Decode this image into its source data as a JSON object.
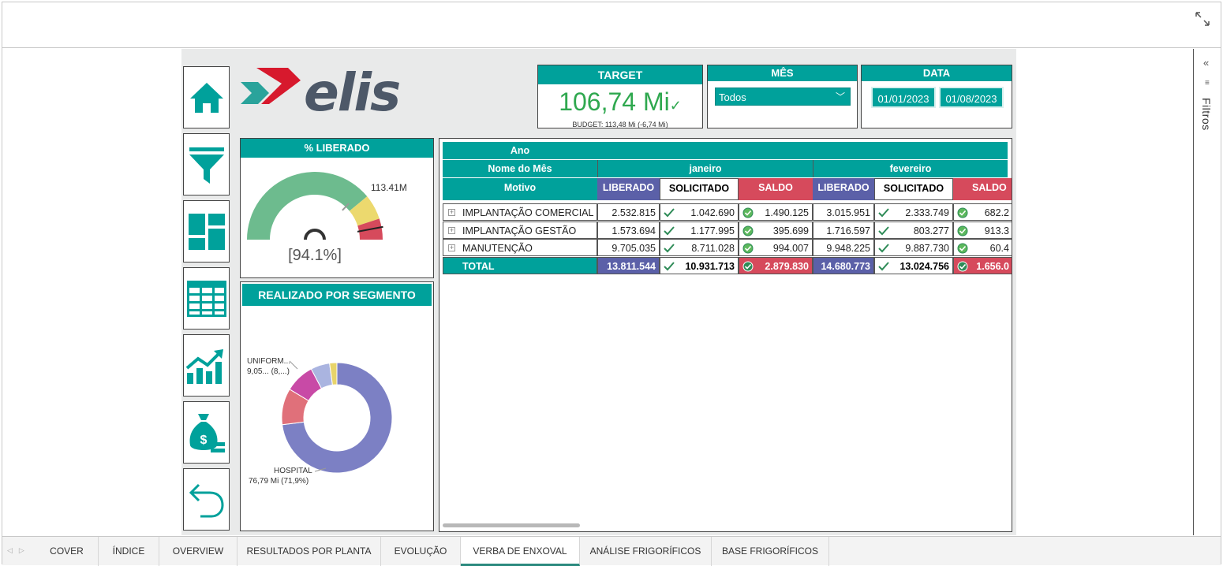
{
  "tabs": [
    "COVER",
    "ÍNDICE",
    "OVERVIEW",
    "RESULTADOS POR PLANTA",
    "EVOLUÇÃO",
    "VERBA DE ENXOVAL",
    "ANÁLISE FRIGORÍFICOS",
    "BASE FRIGORÍFICOS"
  ],
  "active_tab": "VERBA DE ENXOVAL",
  "filters_pane": {
    "label": "Filtros",
    "collapse_icon": "«"
  },
  "nav_buttons": [
    "home-icon",
    "filter-icon",
    "dashboard-icon",
    "table-icon",
    "growth-chart-icon",
    "money-bag-icon",
    "back-arrow-icon"
  ],
  "logo": {
    "text": "elis",
    "colors": {
      "red": "#d7192d",
      "teal": "#2aa39b",
      "slate": "#4d5868"
    }
  },
  "target": {
    "title": "TARGET",
    "value": "106,74 Mi",
    "budget": "BUDGET: 113,48 Mi (-6,74 Mi)"
  },
  "mes": {
    "title": "MÊS",
    "selected": "Todos"
  },
  "data_filter": {
    "title": "DATA",
    "start": "01/01/2023",
    "end": "01/08/2023"
  },
  "gauge": {
    "title": "% LIBERADO",
    "max_label": "113.41M",
    "percent_label": "[94.1%]",
    "value_fraction": 0.941
  },
  "segmento": {
    "title": "REALIZADO POR SEGMENTO",
    "label_top_name": "UNIFORM...",
    "label_top_value": "9,05... (8,...)",
    "label_bottom_name": "HOSPITAL",
    "label_bottom_value": "76,79 Mi (71,9%)"
  },
  "matrix": {
    "row_headers": [
      "Ano",
      "Nome do Mês",
      "Motivo"
    ],
    "months": [
      "janeiro",
      "fevereiro"
    ],
    "measures": [
      "LIBERADO",
      "SOLICITADO",
      "SALDO"
    ],
    "rows": [
      {
        "label": "IMPLANTAÇÃO COMERCIAL",
        "jan": [
          "2.532.815",
          "1.042.690",
          "1.490.125"
        ],
        "fev": [
          "3.015.951",
          "2.333.749",
          "682.2"
        ]
      },
      {
        "label": "IMPLANTAÇÃO GESTÃO",
        "jan": [
          "1.573.694",
          "1.177.995",
          "395.699"
        ],
        "fev": [
          "1.716.597",
          "803.277",
          "913.3"
        ]
      },
      {
        "label": "MANUTENÇÃO",
        "jan": [
          "9.705.035",
          "8.711.028",
          "994.007"
        ],
        "fev": [
          "9.948.225",
          "9.887.730",
          "60.4"
        ]
      }
    ],
    "total": {
      "label": "TOTAL",
      "jan": [
        "13.811.544",
        "10.931.713",
        "2.879.830"
      ],
      "fev": [
        "14.680.773",
        "13.024.756",
        "1.656.0"
      ]
    }
  },
  "chart_data": [
    {
      "type": "pie",
      "title": "REALIZADO POR SEGMENTO",
      "categories": [
        "HOSPITAL",
        "",
        "UNIFORM...",
        "",
        ""
      ],
      "values": [
        71.9,
        10.5,
        8.5,
        5.5,
        2.1
      ],
      "colors": [
        "#7c80c4",
        "#e0707a",
        "#c84aa6",
        "#aab4e0",
        "#e8d46a"
      ],
      "legend": "none"
    },
    {
      "type": "gauge",
      "title": "% LIBERADO",
      "value_fraction": 0.941,
      "max_label": "113.41M",
      "bands": [
        {
          "color": "#6dbb8e",
          "to": 0.78
        },
        {
          "color": "#ecd96e",
          "to": 0.9
        },
        {
          "color": "#d64a5c",
          "to": 1.0
        }
      ]
    }
  ]
}
